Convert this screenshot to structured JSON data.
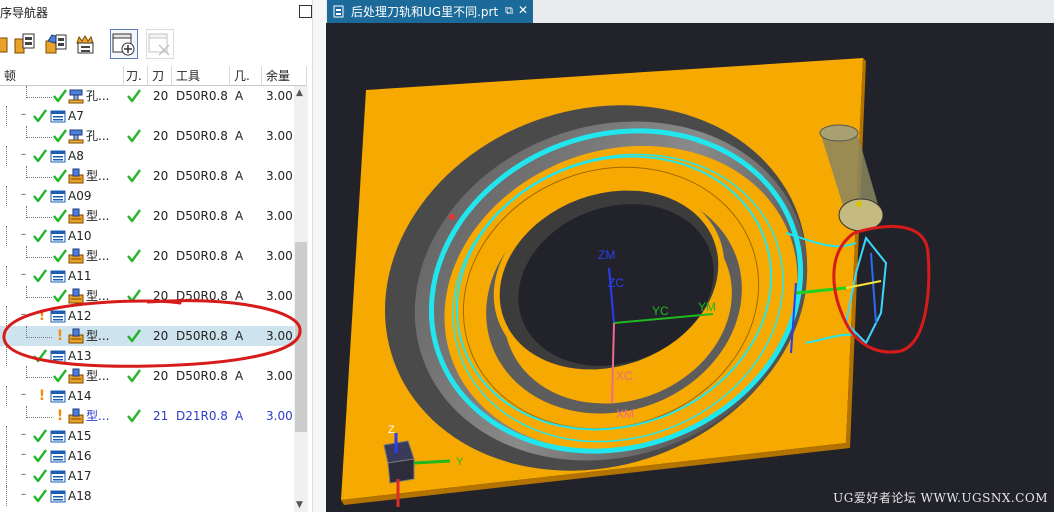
{
  "navigator": {
    "title": "序导航器",
    "columns": [
      "顿",
      "刀.",
      "刀",
      "工具",
      "几.",
      "余量"
    ]
  },
  "tree": {
    "rows": [
      {
        "kind": "op",
        "label": "孔...",
        "status": "check",
        "tool_num": "20",
        "tool": "D50R0.8",
        "geom": "A",
        "stock": "3.00",
        "icon": "drill-op-icon"
      },
      {
        "kind": "group",
        "label": "A7",
        "status": "check"
      },
      {
        "kind": "op",
        "label": "孔...",
        "status": "check",
        "tool_num": "20",
        "tool": "D50R0.8",
        "geom": "A",
        "stock": "3.00",
        "icon": "drill-op-icon"
      },
      {
        "kind": "group",
        "label": "A8",
        "status": "check"
      },
      {
        "kind": "op",
        "label": "型...",
        "status": "check",
        "tool_num": "20",
        "tool": "D50R0.8",
        "geom": "A",
        "stock": "3.00",
        "icon": "cavity-mill-op-icon"
      },
      {
        "kind": "group",
        "label": "A09",
        "status": "check"
      },
      {
        "kind": "op",
        "label": "型...",
        "status": "check",
        "tool_num": "20",
        "tool": "D50R0.8",
        "geom": "A",
        "stock": "3.00",
        "icon": "cavity-mill-op-icon"
      },
      {
        "kind": "group",
        "label": "A10",
        "status": "check"
      },
      {
        "kind": "op",
        "label": "型...",
        "status": "check",
        "tool_num": "20",
        "tool": "D50R0.8",
        "geom": "A",
        "stock": "3.00",
        "icon": "cavity-mill-op-icon"
      },
      {
        "kind": "group",
        "label": "A11",
        "status": "check"
      },
      {
        "kind": "op",
        "label": "型...",
        "status": "check",
        "tool_num": "20",
        "tool": "D50R0.8",
        "geom": "A",
        "stock": "3.00",
        "icon": "cavity-mill-op-icon"
      },
      {
        "kind": "group",
        "label": "A12",
        "status": "warn"
      },
      {
        "kind": "op",
        "label": "型...",
        "status": "warn",
        "tool_num": "20",
        "tool": "D50R0.8",
        "geom": "A",
        "stock": "3.00",
        "icon": "cavity-mill-op-icon",
        "selected": true
      },
      {
        "kind": "group",
        "label": "A13",
        "status": "check"
      },
      {
        "kind": "op",
        "label": "型...",
        "status": "check",
        "tool_num": "20",
        "tool": "D50R0.8",
        "geom": "A",
        "stock": "3.00",
        "icon": "cavity-mill-op-icon"
      },
      {
        "kind": "group",
        "label": "A14",
        "status": "warn"
      },
      {
        "kind": "op",
        "label": "型...",
        "status": "warn",
        "tool_num": "21",
        "tool": "D21R0.8",
        "geom": "A",
        "stock": "3.00",
        "icon": "cavity-mill-op-icon",
        "blue": true
      },
      {
        "kind": "group",
        "label": "A15",
        "status": "check"
      },
      {
        "kind": "group",
        "label": "A16",
        "status": "check"
      },
      {
        "kind": "group",
        "label": "A17",
        "status": "check"
      },
      {
        "kind": "group",
        "label": "A18",
        "status": "check"
      }
    ]
  },
  "graphics": {
    "tab_title": "后处理刀轨和UG里不同.prt",
    "axis_labels": {
      "zm": "ZM",
      "zc": "ZC",
      "yc": "YC",
      "ym": "YM",
      "xc": "XC",
      "xm": "XM"
    },
    "triad_labels": {
      "z": "Z",
      "y": "Y"
    },
    "watermark": "UG爱好者论坛 WWW.UGSNX.COM",
    "colors": {
      "part": "#f5a800",
      "part_dark": "#b27300",
      "toolpath": "#22e6ee",
      "background": "#22232a",
      "annotation": "#d71a1a"
    }
  }
}
